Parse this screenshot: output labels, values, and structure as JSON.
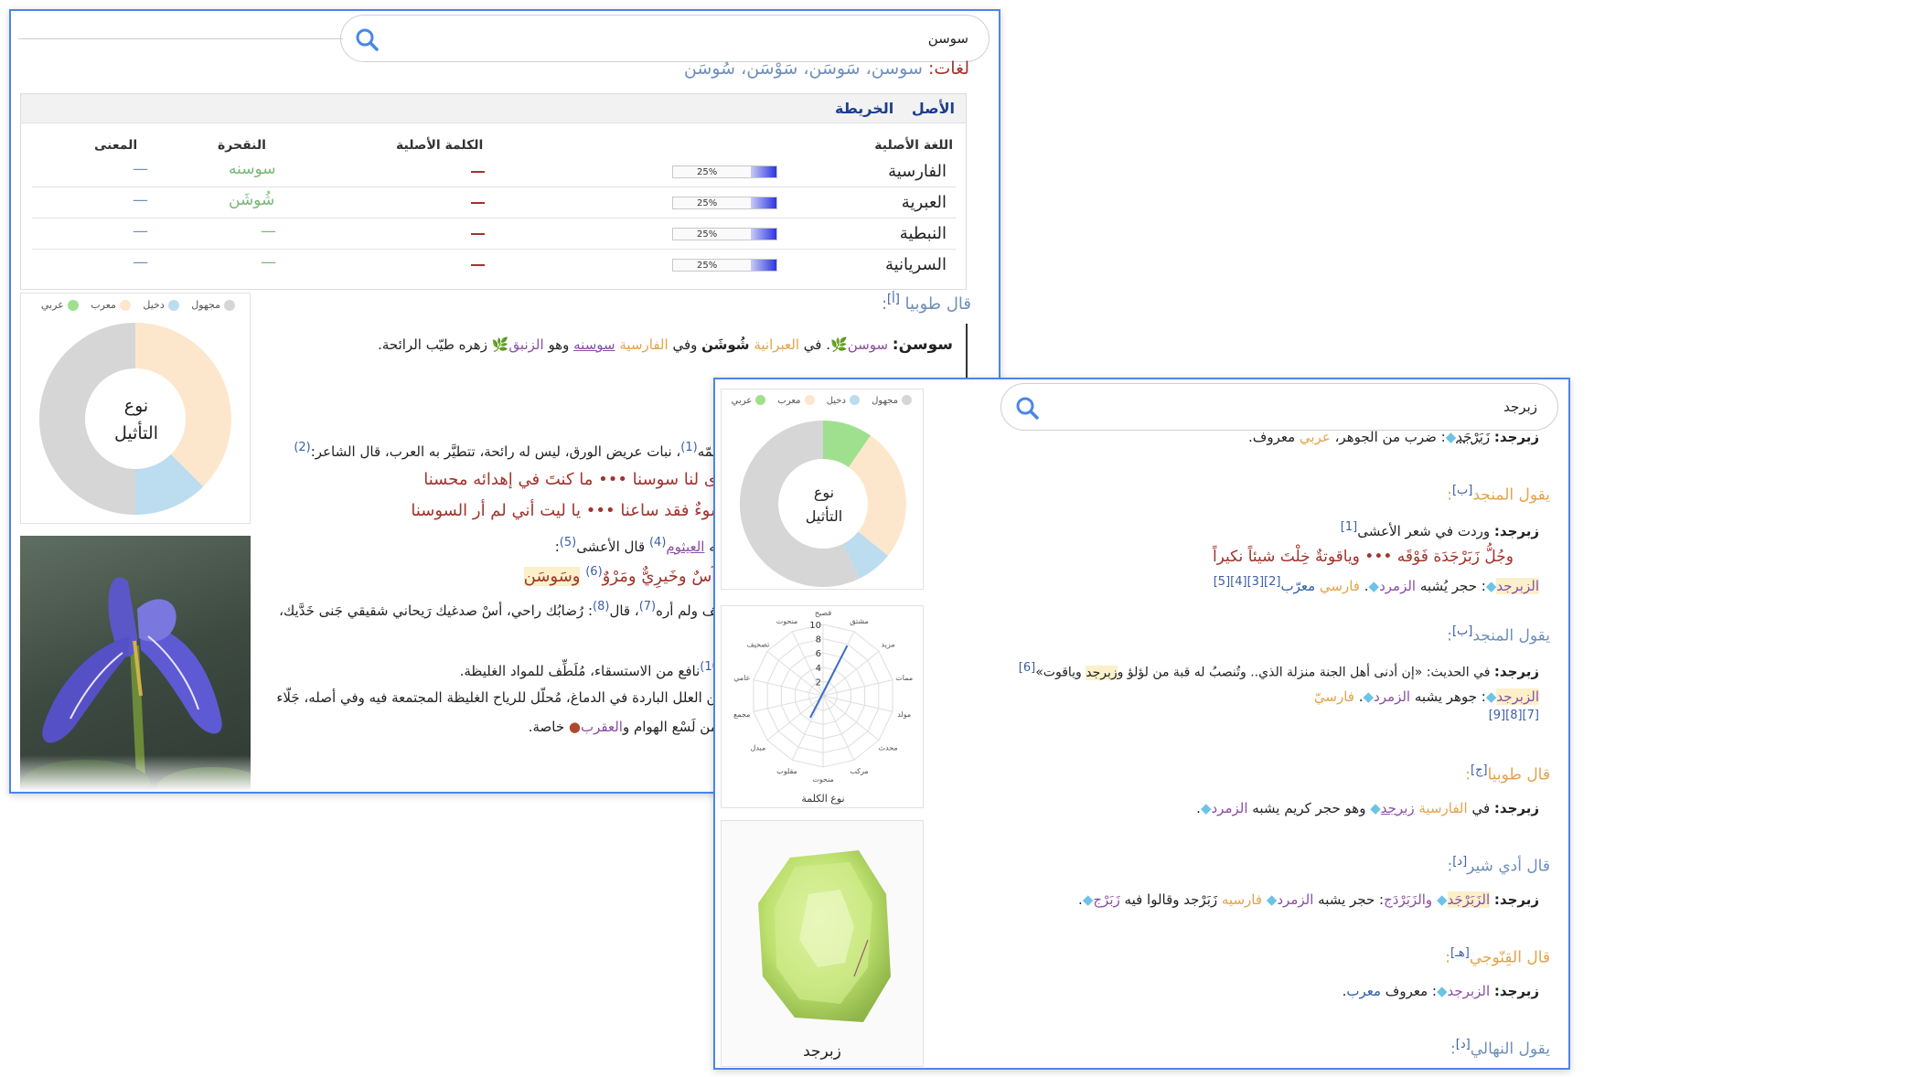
{
  "w1": {
    "search_query": "سوسن",
    "variants_label": "لغات:",
    "variants": "سوسن، سَوسَن، سَوْسَن، سُوسَن",
    "table": {
      "tabs": [
        "الأصل",
        "الخريطة"
      ],
      "headers": [
        "اللغة الأصلية",
        "الكلمة الأصلية",
        "النقحرة",
        "المعنى"
      ],
      "rows": [
        {
          "lang": "الفارسية",
          "pct": "25%",
          "translit": "سوسنه",
          "meaning": "—"
        },
        {
          "lang": "العبرية",
          "pct": "25%",
          "translit": "شُوشَن",
          "meaning": "—"
        },
        {
          "lang": "النبطية",
          "pct": "25%",
          "translit": "—",
          "meaning": "—"
        },
        {
          "lang": "السريانية",
          "pct": "25%",
          "translit": "—",
          "meaning": "—"
        }
      ]
    },
    "legend": [
      "مجهول",
      "دخيل",
      "معرب",
      "عربي"
    ],
    "donut_label_1": "نوع",
    "donut_label_2": "التأثيل",
    "toubia_heading": "قال طوبيا",
    "toubia_ref": "[أ]",
    "entry_word": "سوسن:",
    "entry_p1": "سوسن",
    "entry_p2": ". في",
    "entry_p3": "العبرانية",
    "entry_p4": "شُوشَن",
    "entry_p5": "وفي",
    "entry_p6": "الفارسية",
    "entry_p7": "سوسنه",
    "entry_p8": "وهو",
    "entry_p9": "الزنبق",
    "entry_p10": "زهره طيّب الرائحة.",
    "text_l1a": "سمّه",
    "text_l1ref": "(1)",
    "text_l1b": "، نبات عريض الورق، ليس له رائحة، تتطيَّر به العرب، قال الشاعر:",
    "text_l1ref2": "(2)",
    "poem1": "دى لنا سوسنا ••• ما كنتَ في إهدائه محسنا",
    "poem2": "سوءٌ فقد ساعنا ••• يا ليت أني لم أر السوسنا",
    "text_l4a": "يته",
    "text_l4b": "العيثوم",
    "text_l4ref": "(4)",
    "text_l4c": "قال الأعشى",
    "text_l4ref2": "(5)",
    "text_l4d": ":",
    "poem3": "وآسٌ وخَيرِيٌّ ومَرْوٌ",
    "poem3ref": "(6)",
    "poem3b": "وسَوسَن",
    "text_l6": "ألف ولم أره",
    "text_l6ref": "(7)",
    "text_l6b": "، قال",
    "text_l6ref2": "(8)",
    "text_l6c": ": رُضابُك راحي، أسْ صدغيك رَيحاني شقيقي جَنى خَدَّيك،",
    "text_l7ref": "(10)",
    "text_l7": "نافع من الاستسقاء، مُلَطِّف للمواد الغليظة.",
    "text_l8": "من العلل الباردة في الدماغ، مُحلّل للرياح الغليظة المجتمعة فيه وفي أصله، جَلّاء",
    "text_l9a": "ومن لَسْع الهوام و",
    "text_l9b": "العقرب",
    "text_l9c": "خاصة."
  },
  "w2": {
    "search_query": "زبرجد",
    "legend": [
      "مجهول",
      "دخيل",
      "معرب",
      "عربي"
    ],
    "donut_label_1": "نوع",
    "donut_label_2": "التأثيل",
    "radar": {
      "title": "نوع الكلمة",
      "axes": [
        "فصيح",
        "مشتق",
        "مزيد",
        "ممات",
        "مولد",
        "محدث",
        "مركب",
        "منحوت",
        "مقلوب",
        "مبدل",
        "مجمع",
        "عامي",
        "تصحيف",
        "منحوت"
      ],
      "ticks": [
        "10",
        "8",
        "6",
        "4",
        "2"
      ]
    },
    "image_caption": "زبرجد",
    "lines": {
      "l1_word": "زبرجد:",
      "l1_a": "زَبَرْجَد",
      "l1_b": ": ضرب من الجوهر،",
      "l1_c": "عربي",
      "l1_d": "معروف.",
      "h1": "يقول المنجد",
      "h1_ref": "[ب]",
      "l2_word": "زبرجد:",
      "l2_a": "وردت في شعر الأعشى",
      "l2_ref": "[1]",
      "poem": "وجُلُّ زَبَرْجَدَة فَوْقَه ••• وياقوتةٌ خِلْتَ شيئاً نكيراً",
      "l3_a": "الزبرجد",
      "l3_b": ": حجر يُشبه",
      "l3_c": "الزمرد",
      "l3_d": ".",
      "l3_e": "فارسي",
      "l3_f": "معرّب",
      "l3_refs": "[2][3][4][5]",
      "h2": "يقول المنجد",
      "h2_ref": "[ب]",
      "l4_word": "زبرجد:",
      "l4_a": "في الحديث: «إن أدنى أهل الجنة منزلة الذي.. وتُنصبُ له قبة من لؤلؤ و",
      "l4_b": "زبرجد",
      "l4_c": "وياقوت»",
      "l4_ref": "[6]",
      "l5_a": "الزبرجد",
      "l5_b": ": جوهر يشبه",
      "l5_c": "الزمرد",
      "l5_d": ".",
      "l5_e": "فارسيّ",
      "l5_refs": "[7][8][9]",
      "h3": "قال طوبيا",
      "h3_ref": "[ج]",
      "l6_word": "زبرجد:",
      "l6_a": "في",
      "l6_b": "الفارسية",
      "l6_c": "زبرجد",
      "l6_d": "وهو حجر كريم يشبه",
      "l6_e": "الزمرد",
      "h4": "قال أدي شير",
      "h4_ref": "[د]",
      "l7_word": "زبرجد:",
      "l7_a": "الزَبَرْجَد",
      "l7_b": "والزَبَرْدَج",
      "l7_c": ": حجر يشبه",
      "l7_d": "الزمرد",
      "l7_e": "فارسيه",
      "l7_f": "زَبَرْجد وقالوا فيه",
      "l7_g": "زَبَرْج",
      "h5": "قال القِنّوجي",
      "h5_ref": "[هـ]",
      "l8_word": "زبرجد:",
      "l8_a": "الزبرجد",
      "l8_b": ": معروف",
      "l8_c": "معرب",
      "h6": "يقول النهالي",
      "h6_ref": "[د]"
    }
  },
  "colors": {
    "majhool": "#d6d6d6",
    "dakheel": "#bcdcef",
    "muarrab": "#fde7cc",
    "arabi": "#9fe08f",
    "accent": "#4a86e8",
    "orange": "#e3a34b",
    "purple": "#8a4ea5",
    "red": "#a0342c"
  }
}
